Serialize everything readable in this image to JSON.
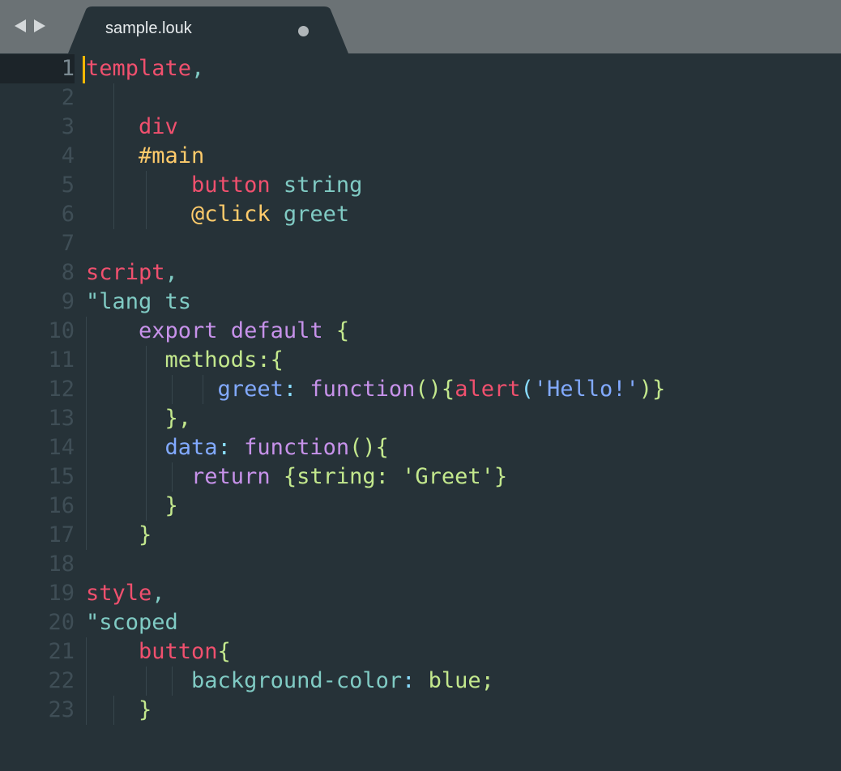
{
  "tab": {
    "title": "sample.louk",
    "modified_dot": "unsaved-indicator"
  },
  "nav": {
    "back_icon": "back-arrow-icon",
    "forward_icon": "forward-arrow-icon"
  },
  "colors": {
    "background": "#263238",
    "tabbar": "#6b7275",
    "caret": "#f5b700",
    "red": "#f0506e",
    "teal": "#80cbc4",
    "yellow": "#ffcb6b",
    "purple": "#c792ea",
    "green": "#c3e88d",
    "blue": "#82aaff"
  },
  "editor": {
    "current_line": 1,
    "lines": [
      {
        "n": "1",
        "tokens": [
          {
            "t": "template",
            "c": "red"
          },
          {
            "t": ",",
            "c": "teal"
          }
        ]
      },
      {
        "n": "2",
        "tokens": []
      },
      {
        "n": "3",
        "tokens": [
          {
            "t": "    div",
            "c": "red"
          }
        ]
      },
      {
        "n": "4",
        "tokens": [
          {
            "t": "    #main",
            "c": "yellow"
          }
        ]
      },
      {
        "n": "5",
        "tokens": [
          {
            "t": "        button",
            "c": "red"
          },
          {
            "t": " string",
            "c": "teal"
          }
        ]
      },
      {
        "n": "6",
        "tokens": [
          {
            "t": "        @click",
            "c": "yellow"
          },
          {
            "t": " greet",
            "c": "teal"
          }
        ]
      },
      {
        "n": "7",
        "tokens": []
      },
      {
        "n": "8",
        "tokens": [
          {
            "t": "script",
            "c": "red"
          },
          {
            "t": ",",
            "c": "teal"
          }
        ]
      },
      {
        "n": "9",
        "tokens": [
          {
            "t": "\"lang ts",
            "c": "teal"
          }
        ]
      },
      {
        "n": "10",
        "tokens": [
          {
            "t": "    export default",
            "c": "purple"
          },
          {
            "t": " {",
            "c": "green"
          }
        ]
      },
      {
        "n": "11",
        "tokens": [
          {
            "t": "      methods:{",
            "c": "green"
          }
        ]
      },
      {
        "n": "12",
        "tokens": [
          {
            "t": "          greet",
            "c": "blue"
          },
          {
            "t": ": ",
            "c": "light"
          },
          {
            "t": "function",
            "c": "purple"
          },
          {
            "t": "(){",
            "c": "green"
          },
          {
            "t": "alert",
            "c": "red"
          },
          {
            "t": "(",
            "c": "light"
          },
          {
            "t": "'Hello!'",
            "c": "blue"
          },
          {
            "t": ")}",
            "c": "green"
          }
        ]
      },
      {
        "n": "13",
        "tokens": [
          {
            "t": "      },",
            "c": "green"
          }
        ]
      },
      {
        "n": "14",
        "tokens": [
          {
            "t": "      data",
            "c": "blue"
          },
          {
            "t": ": ",
            "c": "light"
          },
          {
            "t": "function",
            "c": "purple"
          },
          {
            "t": "(){",
            "c": "green"
          }
        ]
      },
      {
        "n": "15",
        "tokens": [
          {
            "t": "        return",
            "c": "purple"
          },
          {
            "t": " {string: 'Greet'}",
            "c": "green"
          }
        ]
      },
      {
        "n": "16",
        "tokens": [
          {
            "t": "      }",
            "c": "green"
          }
        ]
      },
      {
        "n": "17",
        "tokens": [
          {
            "t": "    }",
            "c": "green"
          }
        ]
      },
      {
        "n": "18",
        "tokens": []
      },
      {
        "n": "19",
        "tokens": [
          {
            "t": "style",
            "c": "red"
          },
          {
            "t": ",",
            "c": "teal"
          }
        ]
      },
      {
        "n": "20",
        "tokens": [
          {
            "t": "\"scoped",
            "c": "teal"
          }
        ]
      },
      {
        "n": "21",
        "tokens": [
          {
            "t": "    button",
            "c": "red"
          },
          {
            "t": "{",
            "c": "green"
          }
        ]
      },
      {
        "n": "22",
        "tokens": [
          {
            "t": "        background-color",
            "c": "teal"
          },
          {
            "t": ": ",
            "c": "light"
          },
          {
            "t": "blue;",
            "c": "green"
          }
        ]
      },
      {
        "n": "23",
        "tokens": [
          {
            "t": "    }",
            "c": "green"
          }
        ]
      }
    ]
  }
}
